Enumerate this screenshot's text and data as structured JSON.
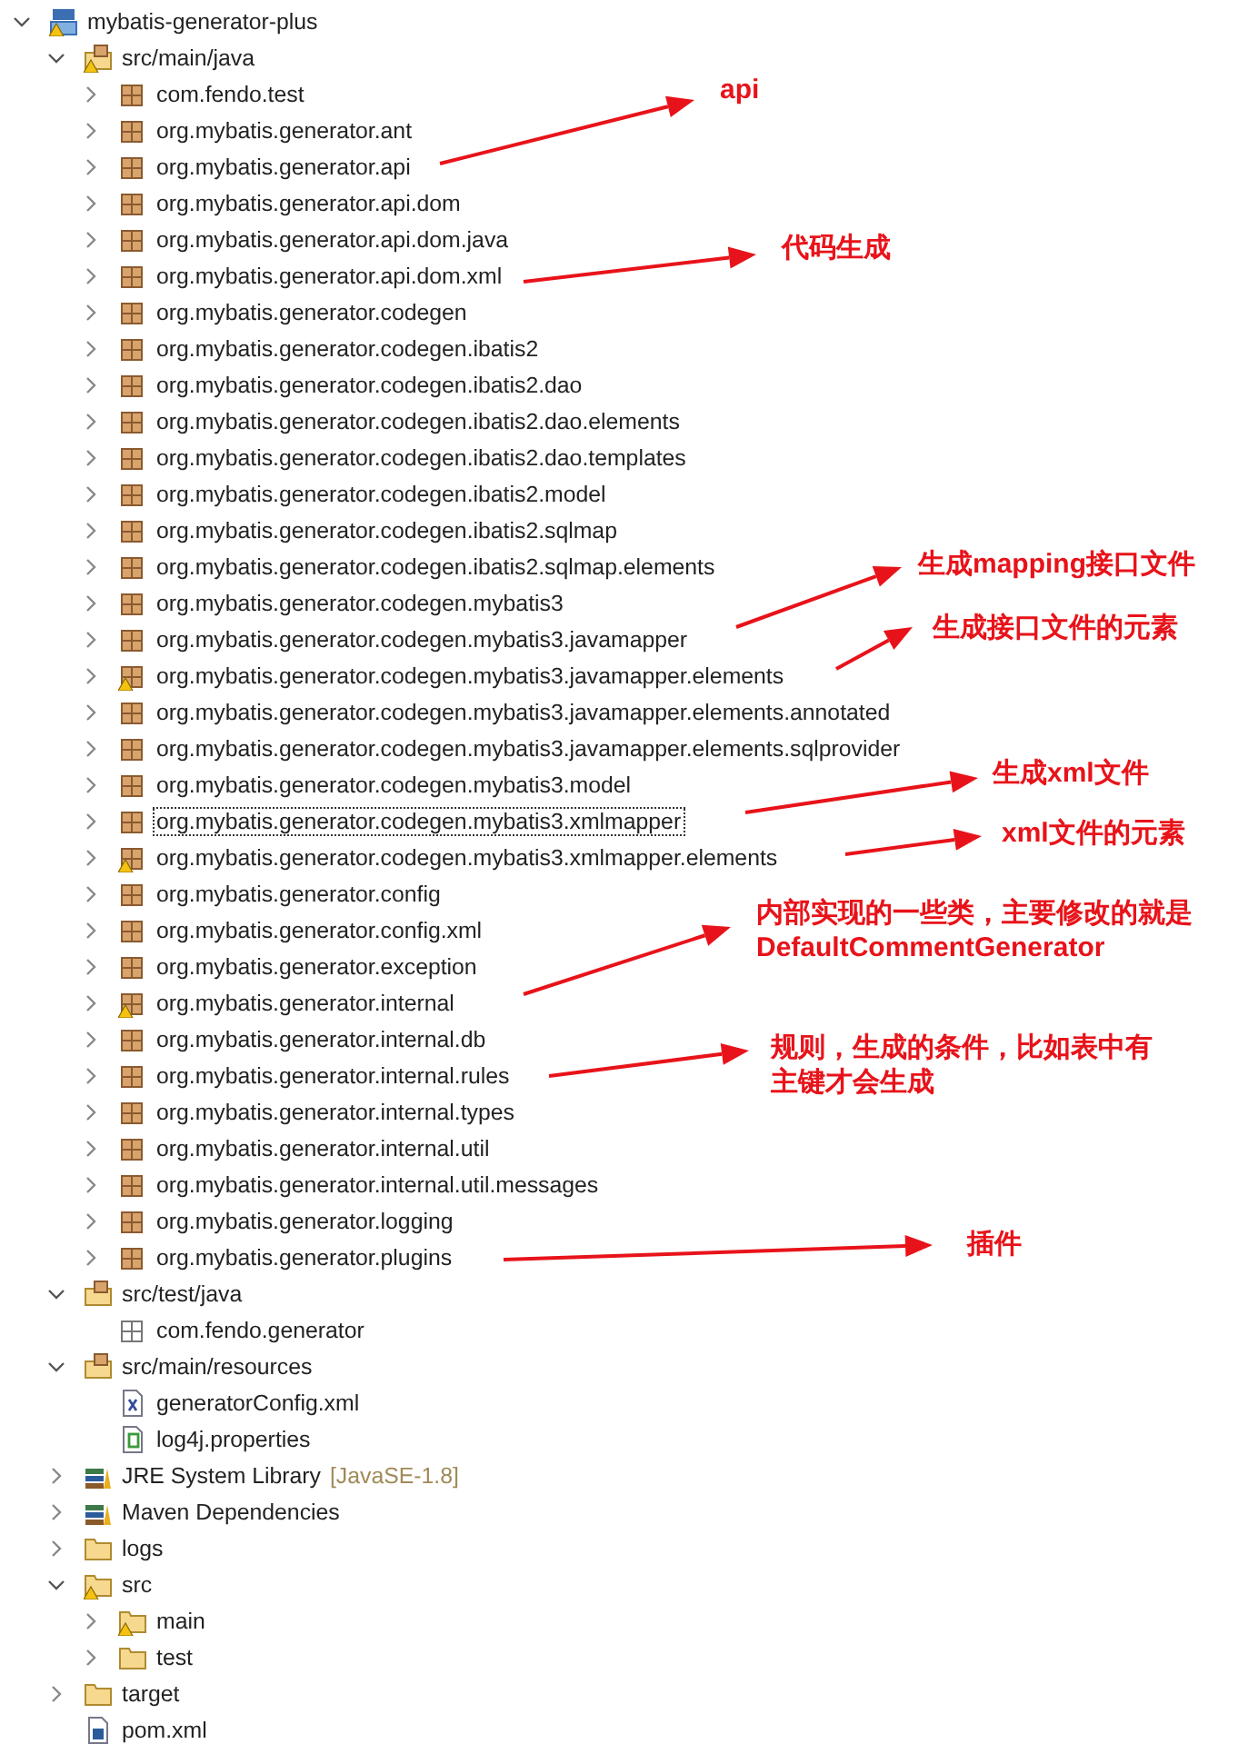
{
  "tree": [
    {
      "label": "mybatis-generator-plus",
      "kind": "project",
      "warning": true,
      "expanded": true,
      "focused": false,
      "children": [
        {
          "label": "src/main/java",
          "kind": "source-folder",
          "warning": true,
          "expanded": true,
          "focused": false,
          "children": [
            {
              "label": "com.fendo.test",
              "kind": "package",
              "warning": false,
              "expanded": false,
              "focused": false
            },
            {
              "label": "org.mybatis.generator.ant",
              "kind": "package",
              "warning": false,
              "expanded": false,
              "focused": false
            },
            {
              "label": "org.mybatis.generator.api",
              "kind": "package",
              "warning": false,
              "expanded": false,
              "focused": false
            },
            {
              "label": "org.mybatis.generator.api.dom",
              "kind": "package",
              "warning": false,
              "expanded": false,
              "focused": false
            },
            {
              "label": "org.mybatis.generator.api.dom.java",
              "kind": "package",
              "warning": false,
              "expanded": false,
              "focused": false
            },
            {
              "label": "org.mybatis.generator.api.dom.xml",
              "kind": "package",
              "warning": false,
              "expanded": false,
              "focused": false
            },
            {
              "label": "org.mybatis.generator.codegen",
              "kind": "package",
              "warning": false,
              "expanded": false,
              "focused": false
            },
            {
              "label": "org.mybatis.generator.codegen.ibatis2",
              "kind": "package",
              "warning": false,
              "expanded": false,
              "focused": false
            },
            {
              "label": "org.mybatis.generator.codegen.ibatis2.dao",
              "kind": "package",
              "warning": false,
              "expanded": false,
              "focused": false
            },
            {
              "label": "org.mybatis.generator.codegen.ibatis2.dao.elements",
              "kind": "package",
              "warning": false,
              "expanded": false,
              "focused": false
            },
            {
              "label": "org.mybatis.generator.codegen.ibatis2.dao.templates",
              "kind": "package",
              "warning": false,
              "expanded": false,
              "focused": false
            },
            {
              "label": "org.mybatis.generator.codegen.ibatis2.model",
              "kind": "package",
              "warning": false,
              "expanded": false,
              "focused": false
            },
            {
              "label": "org.mybatis.generator.codegen.ibatis2.sqlmap",
              "kind": "package",
              "warning": false,
              "expanded": false,
              "focused": false
            },
            {
              "label": "org.mybatis.generator.codegen.ibatis2.sqlmap.elements",
              "kind": "package",
              "warning": false,
              "expanded": false,
              "focused": false
            },
            {
              "label": "org.mybatis.generator.codegen.mybatis3",
              "kind": "package",
              "warning": false,
              "expanded": false,
              "focused": false
            },
            {
              "label": "org.mybatis.generator.codegen.mybatis3.javamapper",
              "kind": "package",
              "warning": false,
              "expanded": false,
              "focused": false
            },
            {
              "label": "org.mybatis.generator.codegen.mybatis3.javamapper.elements",
              "kind": "package",
              "warning": true,
              "expanded": false,
              "focused": false
            },
            {
              "label": "org.mybatis.generator.codegen.mybatis3.javamapper.elements.annotated",
              "kind": "package",
              "warning": false,
              "expanded": false,
              "focused": false
            },
            {
              "label": "org.mybatis.generator.codegen.mybatis3.javamapper.elements.sqlprovider",
              "kind": "package",
              "warning": false,
              "expanded": false,
              "focused": false
            },
            {
              "label": "org.mybatis.generator.codegen.mybatis3.model",
              "kind": "package",
              "warning": false,
              "expanded": false,
              "focused": false
            },
            {
              "label": "org.mybatis.generator.codegen.mybatis3.xmlmapper",
              "kind": "package",
              "warning": false,
              "expanded": false,
              "focused": true
            },
            {
              "label": "org.mybatis.generator.codegen.mybatis3.xmlmapper.elements",
              "kind": "package",
              "warning": true,
              "expanded": false,
              "focused": false
            },
            {
              "label": "org.mybatis.generator.config",
              "kind": "package",
              "warning": false,
              "expanded": false,
              "focused": false
            },
            {
              "label": "org.mybatis.generator.config.xml",
              "kind": "package",
              "warning": false,
              "expanded": false,
              "focused": false
            },
            {
              "label": "org.mybatis.generator.exception",
              "kind": "package",
              "warning": false,
              "expanded": false,
              "focused": false
            },
            {
              "label": "org.mybatis.generator.internal",
              "kind": "package",
              "warning": true,
              "expanded": false,
              "focused": false
            },
            {
              "label": "org.mybatis.generator.internal.db",
              "kind": "package",
              "warning": false,
              "expanded": false,
              "focused": false
            },
            {
              "label": "org.mybatis.generator.internal.rules",
              "kind": "package",
              "warning": false,
              "expanded": false,
              "focused": false
            },
            {
              "label": "org.mybatis.generator.internal.types",
              "kind": "package",
              "warning": false,
              "expanded": false,
              "focused": false
            },
            {
              "label": "org.mybatis.generator.internal.util",
              "kind": "package",
              "warning": false,
              "expanded": false,
              "focused": false
            },
            {
              "label": "org.mybatis.generator.internal.util.messages",
              "kind": "package",
              "warning": false,
              "expanded": false,
              "focused": false
            },
            {
              "label": "org.mybatis.generator.logging",
              "kind": "package",
              "warning": false,
              "expanded": false,
              "focused": false
            },
            {
              "label": "org.mybatis.generator.plugins",
              "kind": "package",
              "warning": false,
              "expanded": false,
              "focused": false
            }
          ]
        },
        {
          "label": "src/test/java",
          "kind": "source-folder",
          "warning": false,
          "expanded": true,
          "focused": false,
          "children": [
            {
              "label": "com.fendo.generator",
              "kind": "empty-package",
              "warning": false,
              "focused": false
            }
          ]
        },
        {
          "label": "src/main/resources",
          "kind": "source-folder",
          "warning": false,
          "expanded": true,
          "focused": false,
          "children": [
            {
              "label": "generatorConfig.xml",
              "kind": "xml-file",
              "warning": false,
              "focused": false
            },
            {
              "label": "log4j.properties",
              "kind": "properties-file",
              "warning": false,
              "focused": false
            }
          ]
        },
        {
          "label": "JRE System Library",
          "decoration": "[JavaSE-1.8]",
          "kind": "library",
          "warning": false,
          "expanded": false,
          "focused": false
        },
        {
          "label": "Maven Dependencies",
          "kind": "library",
          "warning": false,
          "expanded": false,
          "focused": false
        },
        {
          "label": "logs",
          "kind": "folder",
          "warning": false,
          "expanded": false,
          "focused": false
        },
        {
          "label": "src",
          "kind": "folder",
          "warning": true,
          "expanded": true,
          "focused": false,
          "children": [
            {
              "label": "main",
              "kind": "folder",
              "warning": true,
              "expanded": false,
              "focused": false
            },
            {
              "label": "test",
              "kind": "folder",
              "warning": false,
              "expanded": false,
              "focused": false
            }
          ]
        },
        {
          "label": "target",
          "kind": "folder",
          "warning": false,
          "expanded": false,
          "focused": false
        },
        {
          "label": "pom.xml",
          "kind": "pom-file",
          "warning": false,
          "focused": false
        }
      ]
    }
  ],
  "annotations": [
    {
      "lines": [
        "api"
      ]
    },
    {
      "lines": [
        "代码生成"
      ]
    },
    {
      "lines": [
        "生成mapping接口文件"
      ]
    },
    {
      "lines": [
        "生成接口文件的元素"
      ]
    },
    {
      "lines": [
        "生成xml文件"
      ]
    },
    {
      "lines": [
        "xml文件的元素"
      ]
    },
    {
      "lines": [
        "内部实现的一些类，主要修改的就是",
        "DefaultCommentGenerator"
      ]
    },
    {
      "lines": [
        "规则，生成的条件，比如表中有",
        "主键才会生成"
      ]
    },
    {
      "lines": [
        "插件"
      ]
    }
  ]
}
